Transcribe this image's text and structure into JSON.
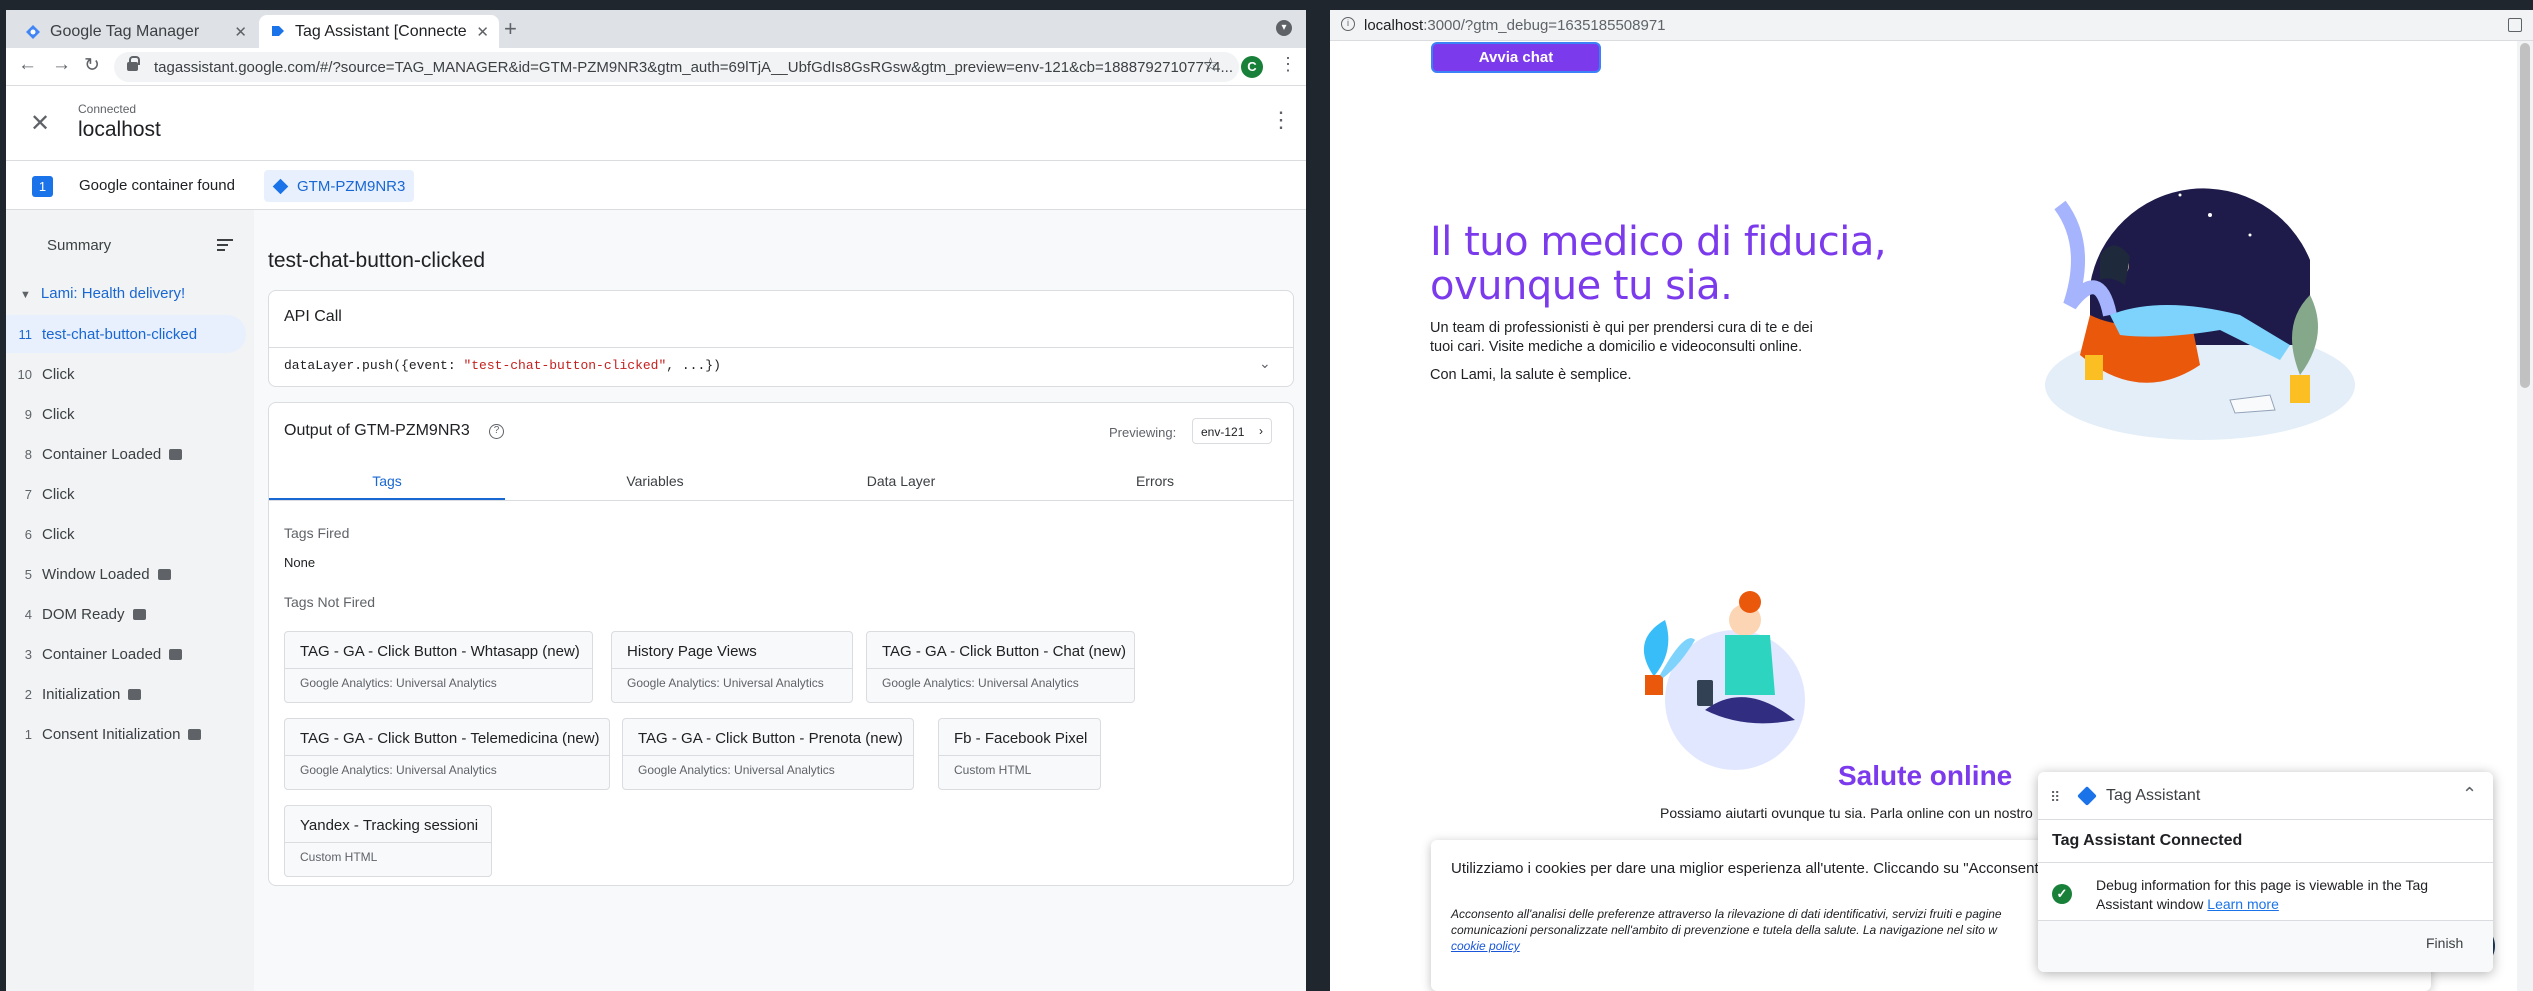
{
  "left_browser": {
    "tabs": [
      {
        "title": "Google Tag Manager",
        "active": false
      },
      {
        "title": "Tag Assistant [Connecte",
        "active": true
      }
    ],
    "url": "tagassistant.google.com/#/?source=TAG_MANAGER&id=GTM-PZM9NR3&gtm_auth=69lTjA__UbfGdIs8GsRGsw&gtm_preview=env-121&cb=18887927107774...",
    "avatar_letter": "C"
  },
  "tag_assistant": {
    "status": "Connected",
    "host": "localhost",
    "container_count": "1",
    "container_found": "Google container found",
    "container_id": "GTM-PZM9NR3",
    "summary": "Summary",
    "container_title": "Lami: Health delivery!",
    "events": [
      {
        "num": "11",
        "name": "test-chat-button-clicked",
        "badge": false,
        "selected": true
      },
      {
        "num": "10",
        "name": "Click",
        "badge": false,
        "selected": false
      },
      {
        "num": "9",
        "name": "Click",
        "badge": false,
        "selected": false
      },
      {
        "num": "8",
        "name": "Container Loaded",
        "badge": true,
        "selected": false
      },
      {
        "num": "7",
        "name": "Click",
        "badge": false,
        "selected": false
      },
      {
        "num": "6",
        "name": "Click",
        "badge": false,
        "selected": false
      },
      {
        "num": "5",
        "name": "Window Loaded",
        "badge": true,
        "selected": false
      },
      {
        "num": "4",
        "name": "DOM Ready",
        "badge": true,
        "selected": false
      },
      {
        "num": "3",
        "name": "Container Loaded",
        "badge": true,
        "selected": false
      },
      {
        "num": "2",
        "name": "Initialization",
        "badge": true,
        "selected": false
      },
      {
        "num": "1",
        "name": "Consent Initialization",
        "badge": true,
        "selected": false
      }
    ],
    "event_title": "test-chat-button-clicked",
    "api_call": {
      "title": "API Call",
      "code_prefix": "dataLayer.push({event: ",
      "code_string": "\"test-chat-button-clicked\"",
      "code_suffix": ", ...})"
    },
    "output": {
      "title": "Output of GTM-PZM9NR3",
      "previewing_label": "Previewing:",
      "env": "env-121",
      "tabs": [
        "Tags",
        "Variables",
        "Data Layer",
        "Errors"
      ],
      "tags_fired_label": "Tags Fired",
      "tags_fired_value": "None",
      "tags_not_fired_label": "Tags Not Fired",
      "tags_not_fired": [
        {
          "name": "TAG - GA - Click Button - Whtasapp (new)",
          "type": "Google Analytics: Universal Analytics"
        },
        {
          "name": "History Page Views",
          "type": "Google Analytics: Universal Analytics"
        },
        {
          "name": "TAG - GA - Click Button - Chat (new)",
          "type": "Google Analytics: Universal Analytics"
        },
        {
          "name": "TAG - GA - Click Button - Telemedicina (new)",
          "type": "Google Analytics: Universal Analytics"
        },
        {
          "name": "TAG - GA - Click Button - Prenota (new)",
          "type": "Google Analytics: Universal Analytics"
        },
        {
          "name": "Fb - Facebook Pixel",
          "type": "Custom HTML"
        },
        {
          "name": "Yandex - Tracking sessioni",
          "type": "Custom HTML"
        }
      ]
    }
  },
  "right_browser": {
    "url_host": "localhost",
    "url_rest": ":3000/?gtm_debug=1635185508971",
    "chat_button": "Avvia chat",
    "hero_line1": "Il tuo medico di fiducia,",
    "hero_line2": "ovunque tu sia.",
    "hero_paragraph": "Un team di professionisti è qui per prendersi cura di te e dei tuoi cari. Visite mediche a domicilio e videoconsulti online.",
    "hero_paragraph2": "Con Lami, la salute è semplice.",
    "section_title": "Salute online",
    "section_text": "Possiamo aiutarti ovunque tu sia. Parla online con un nostro",
    "cookie_text": "Utilizziamo i cookies per dare una miglior esperienza all'utente. Cliccando su \"Acconsento\",",
    "cookie_detail": "Acconsento all'analisi delle preferenze attraverso la rilevazione di dati identificativi, servizi fruiti e pagine comunicazioni personalizzate nell'ambito di prevenzione e tutela della salute. La navigazione nel sito w",
    "cookie_link": "cookie policy",
    "popup": {
      "title": "Tag Assistant",
      "connected": "Tag Assistant Connected",
      "message": "Debug information for this page is viewable in the Tag Assistant window",
      "learn_more": "Learn more",
      "finish": "Finish"
    }
  },
  "colors": {
    "accent_purple": "#7c3aed",
    "google_blue": "#1a73e8",
    "success_green": "#188038"
  }
}
